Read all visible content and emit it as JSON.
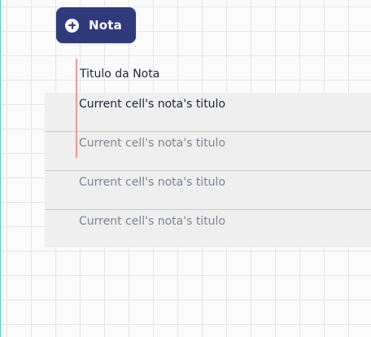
{
  "toolbar": {
    "add_label": "Nota",
    "add_icon": "plus-circle-icon"
  },
  "list": {
    "header": "Titulo da Nota",
    "rows": [
      {
        "title": "Current cell's nota's titulo",
        "selected": true
      },
      {
        "title": "Current cell's nota's titulo",
        "selected": false
      },
      {
        "title": "Current cell's nota's titulo",
        "selected": false
      },
      {
        "title": "Current cell's nota's titulo",
        "selected": false
      }
    ]
  },
  "colors": {
    "button_bg": "#2f3a7b",
    "list_bg": "#efefef",
    "cursor": "#e89a9a",
    "grid": "#e4e6ea"
  }
}
